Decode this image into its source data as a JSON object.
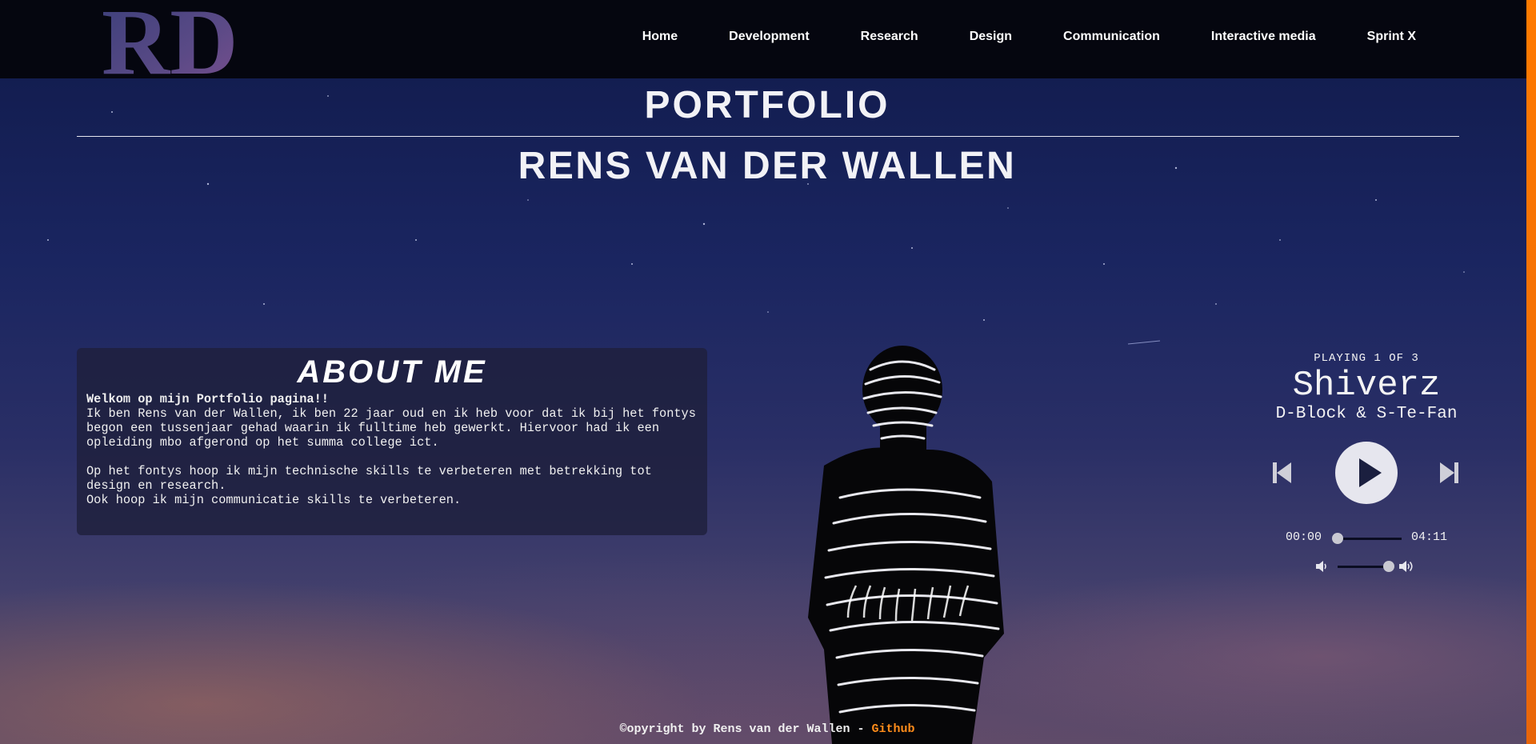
{
  "nav": {
    "items": [
      {
        "label": "Home"
      },
      {
        "label": "Development"
      },
      {
        "label": "Research"
      },
      {
        "label": "Design"
      },
      {
        "label": "Communication"
      },
      {
        "label": "Interactive media"
      },
      {
        "label": "Sprint X"
      }
    ]
  },
  "logo": {
    "text": "RD"
  },
  "header": {
    "title": "PORTFOLIO",
    "subtitle": "RENS VAN DER WALLEN"
  },
  "about": {
    "heading": "ABOUT ME",
    "welcome": "Welkom op mijn Portfolio pagina!!",
    "para1": "Ik ben Rens van der Wallen, ik ben 22 jaar oud en ik heb voor dat ik bij het fontys begon een tussenjaar gehad waarin ik fulltime heb gewerkt. Hiervoor had ik een opleiding mbo afgerond op het summa college ict.",
    "para2": "Op het fontys hoop ik mijn technische skills te verbeteren met betrekking tot design en research.",
    "para3": "Ook hoop ik mijn communicatie skills te verbeteren."
  },
  "player": {
    "playing": "PLAYING 1 OF 3",
    "song": "Shiverz",
    "artist": "D-Block & S-Te-Fan",
    "current_time": "00:00",
    "duration": "04:11",
    "progress": 0.0,
    "volume": 1.0
  },
  "footer": {
    "copyright": "©opyright by Rens van der Wallen - ",
    "github": "Github"
  },
  "colors": {
    "accent": "#ff8c1a",
    "header_bg": "#05060f",
    "card_bg": "#1e203c"
  }
}
